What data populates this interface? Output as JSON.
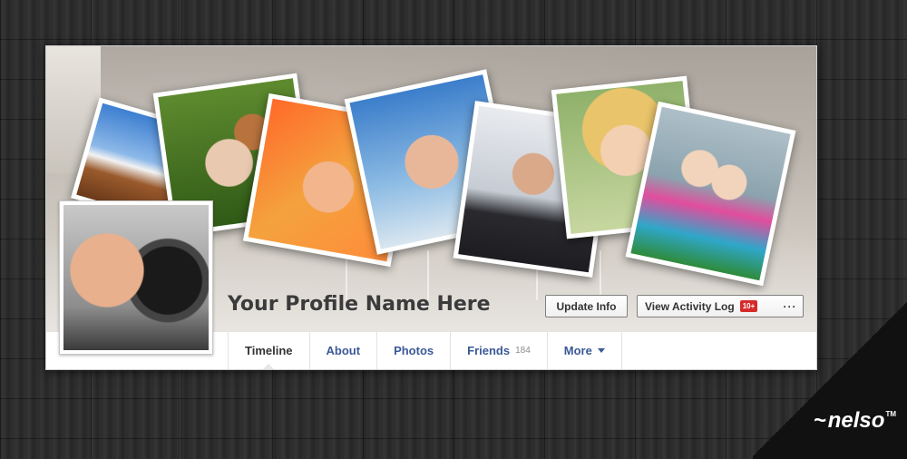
{
  "profile": {
    "name": "Your Profile Name Here"
  },
  "actions": {
    "update_info": "Update Info",
    "view_activity_log": "View Activity Log",
    "activity_badge": "10+",
    "more_menu": "···"
  },
  "tabs": [
    {
      "label": "Timeline",
      "active": true
    },
    {
      "label": "About"
    },
    {
      "label": "Photos"
    },
    {
      "label": "Friends",
      "count": "184"
    },
    {
      "label": "More"
    }
  ],
  "brand": {
    "logo_text": "nelso",
    "tm": "TM"
  },
  "colors": {
    "link_blue": "#3b5998",
    "badge_red": "#d62a2a"
  }
}
